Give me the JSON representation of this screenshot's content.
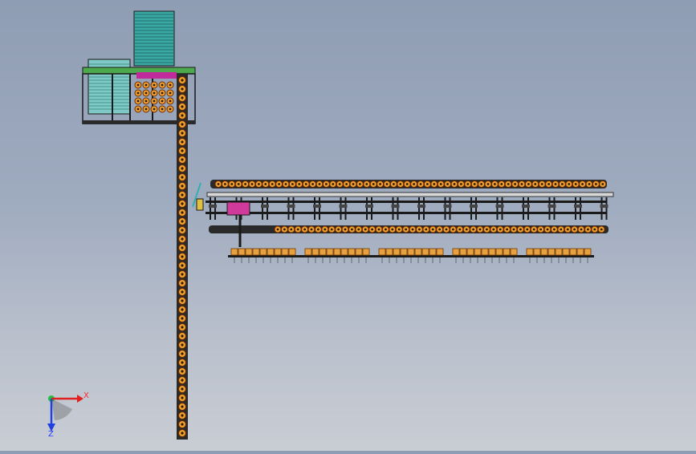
{
  "viewport": {
    "background_top": "#8f9db4",
    "background_bottom": "#c9cdd4"
  },
  "colors": {
    "roller_fill": "#f0a030",
    "roller_stroke": "#6a2a00",
    "frame": "#1a1a1a",
    "rack_teal": "#2f9c9a",
    "rack_light": "#8fd3cf",
    "frame_green": "#2e8b3a",
    "accent_magenta": "#c02a9a",
    "carton": "#e8a040"
  },
  "triad": {
    "x_label": "X",
    "z_label": "Z",
    "x_color": "#e02020",
    "y_color": "#20c040",
    "z_color": "#2040e0",
    "icon": "coordinate-triad-icon"
  }
}
